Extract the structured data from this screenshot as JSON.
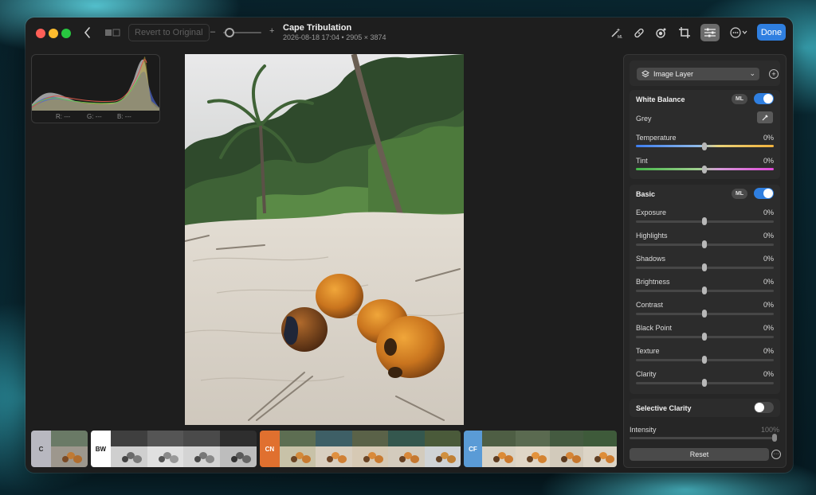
{
  "titlebar": {
    "revert_label": "Revert to Original",
    "zoom_minus": "–",
    "zoom_plus": "+",
    "doc_title": "Cape Tribulation",
    "doc_subtitle": "2026-08-18 17:04 • 2905 × 3874",
    "done_label": "Done",
    "tools": [
      "magic-wand-ml-icon",
      "bandage-retouch-icon",
      "color-mask-icon",
      "crop-icon",
      "adjust-sliders-icon",
      "more-menu-icon"
    ]
  },
  "histogram": {
    "r_label": "R: ---",
    "g_label": "G: ---",
    "b_label": "B: ---"
  },
  "filmstrip": {
    "groups": [
      {
        "tag": "C",
        "color": "#b8b8c0",
        "text_color": "#2a2a2a",
        "count": 1
      },
      {
        "tag": "BW",
        "color": "#ffffff",
        "text_color": "#111111",
        "count": 4
      },
      {
        "tag": "CN",
        "color": "#e0702f",
        "text_color": "#ffffff",
        "count": 5
      },
      {
        "tag": "CF",
        "color": "#5a9bd6",
        "text_color": "#ffffff",
        "count": 4
      }
    ]
  },
  "panel": {
    "layer": {
      "label": "Image Layer",
      "add": "+"
    },
    "white_balance": {
      "title": "White Balance",
      "ml": "ML",
      "enabled": true,
      "grey_label": "Grey",
      "rows": [
        {
          "label": "Temperature",
          "value": "0%"
        },
        {
          "label": "Tint",
          "value": "0%"
        }
      ]
    },
    "basic": {
      "title": "Basic",
      "ml": "ML",
      "enabled": true,
      "rows": [
        {
          "label": "Exposure",
          "value": "0%"
        },
        {
          "label": "Highlights",
          "value": "0%"
        },
        {
          "label": "Shadows",
          "value": "0%"
        },
        {
          "label": "Brightness",
          "value": "0%"
        },
        {
          "label": "Contrast",
          "value": "0%"
        },
        {
          "label": "Black Point",
          "value": "0%"
        },
        {
          "label": "Texture",
          "value": "0%"
        },
        {
          "label": "Clarity",
          "value": "0%"
        }
      ]
    },
    "selective_clarity": {
      "title": "Selective Clarity",
      "enabled": false
    },
    "intensity": {
      "label": "Intensity",
      "value": "100%"
    },
    "reset_label": "Reset",
    "more": "···"
  },
  "colors": {
    "accent": "#2f7fe0",
    "window_bg": "#1e1e1e",
    "panel_bg": "#262626"
  }
}
